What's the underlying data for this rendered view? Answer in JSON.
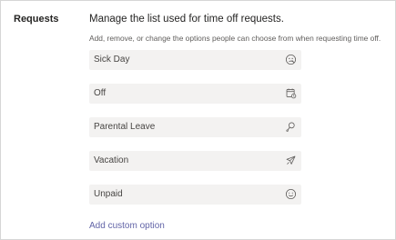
{
  "section": {
    "label": "Requests",
    "heading": "Manage the list used for time off requests.",
    "subtext": "Add, remove, or change the options people can choose from when requesting time off."
  },
  "options": [
    {
      "label": "Sick Day",
      "icon": "sick-face-icon"
    },
    {
      "label": "Off",
      "icon": "calendar-icon"
    },
    {
      "label": "Parental Leave",
      "icon": "baby-rattle-icon"
    },
    {
      "label": "Vacation",
      "icon": "airplane-icon"
    },
    {
      "label": "Unpaid",
      "icon": "smiley-icon"
    }
  ],
  "add_option_label": "Add custom option",
  "colors": {
    "link": "#6264a7",
    "field_background": "#f3f2f1"
  }
}
